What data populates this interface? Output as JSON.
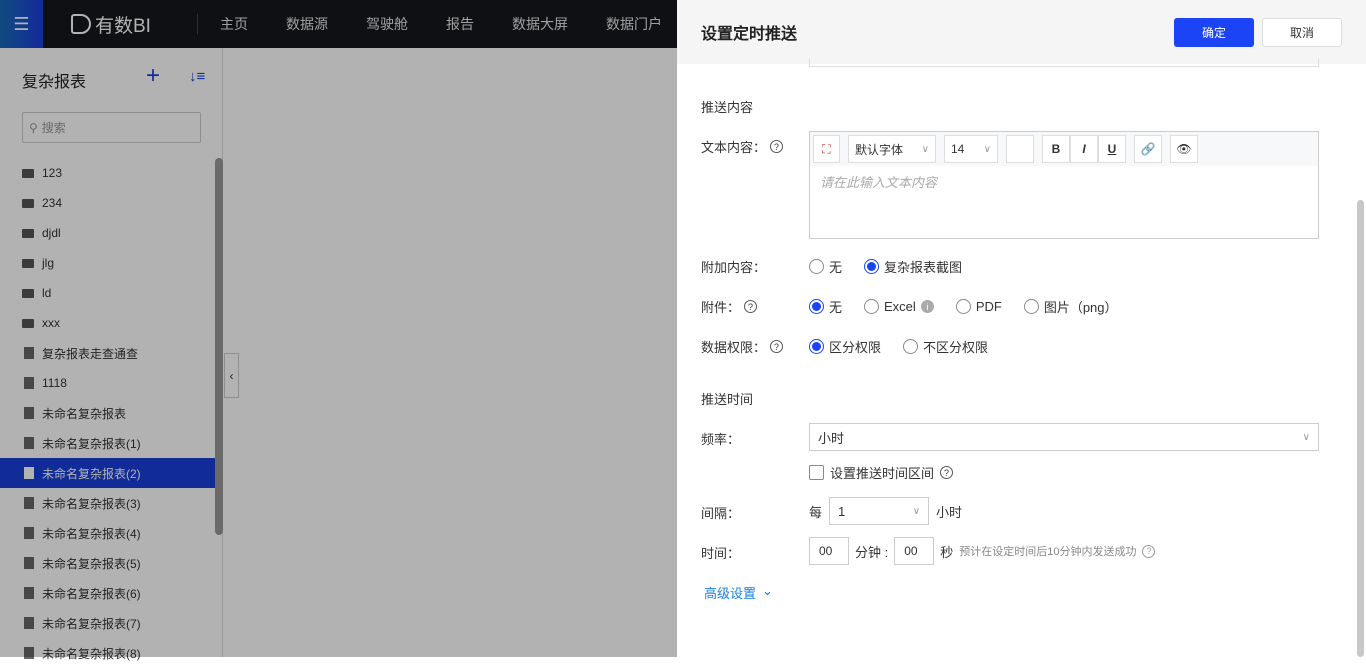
{
  "topbar": {
    "brand": "有数BI",
    "nav": [
      "主页",
      "数据源",
      "驾驶舱",
      "报告",
      "数据大屏",
      "数据门户"
    ]
  },
  "sidebar": {
    "title": "复杂报表",
    "search_placeholder": "搜索",
    "items": [
      {
        "label": "123",
        "type": "folder"
      },
      {
        "label": "234",
        "type": "folder"
      },
      {
        "label": "djdl",
        "type": "folder"
      },
      {
        "label": "jlg",
        "type": "folder"
      },
      {
        "label": "ld",
        "type": "folder"
      },
      {
        "label": "xxx",
        "type": "folder"
      },
      {
        "label": "复杂报表走查通查",
        "type": "doc"
      },
      {
        "label": "1118",
        "type": "doc"
      },
      {
        "label": "未命名复杂报表",
        "type": "doc"
      },
      {
        "label": "未命名复杂报表(1)",
        "type": "doc"
      },
      {
        "label": "未命名复杂报表(2)",
        "type": "doc",
        "selected": true
      },
      {
        "label": "未命名复杂报表(3)",
        "type": "doc"
      },
      {
        "label": "未命名复杂报表(4)",
        "type": "doc"
      },
      {
        "label": "未命名复杂报表(5)",
        "type": "doc"
      },
      {
        "label": "未命名复杂报表(6)",
        "type": "doc"
      },
      {
        "label": "未命名复杂报表(7)",
        "type": "doc"
      },
      {
        "label": "未命名复杂报表(8)",
        "type": "doc"
      }
    ]
  },
  "panel": {
    "title": "设置定时推送",
    "ok": "确定",
    "cancel": "取消",
    "content_section": "推送内容",
    "text_label": "文本内容：",
    "font": "默认字体",
    "size": "14",
    "placeholder": "请在此输入文本内容",
    "bold": "B",
    "italic": "I",
    "underline": "U",
    "attach_content_label": "附加内容：",
    "attach_content_options": [
      "无",
      "复杂报表截图"
    ],
    "attach_content_selected": 1,
    "attachment_label": "附件：",
    "attachment_options": [
      "无",
      "Excel",
      "PDF",
      "图片（png）"
    ],
    "attachment_selected": 0,
    "perm_label": "数据权限：",
    "perm_options": [
      "区分权限",
      "不区分权限"
    ],
    "perm_selected": 0,
    "time_section": "推送时间",
    "freq_label": "频率：",
    "freq_value": "小时",
    "range_checkbox": "设置推送时间区间",
    "range_checked": false,
    "interval_label": "间隔：",
    "interval_prefix": "每",
    "interval_value": "1",
    "interval_unit": "小时",
    "time_label": "时间：",
    "minutes": "00",
    "minutes_unit": "分钟 :",
    "seconds": "00",
    "seconds_unit": "秒",
    "time_hint": "预计在设定时间后10分钟内发送成功",
    "advanced": "高级设置"
  }
}
